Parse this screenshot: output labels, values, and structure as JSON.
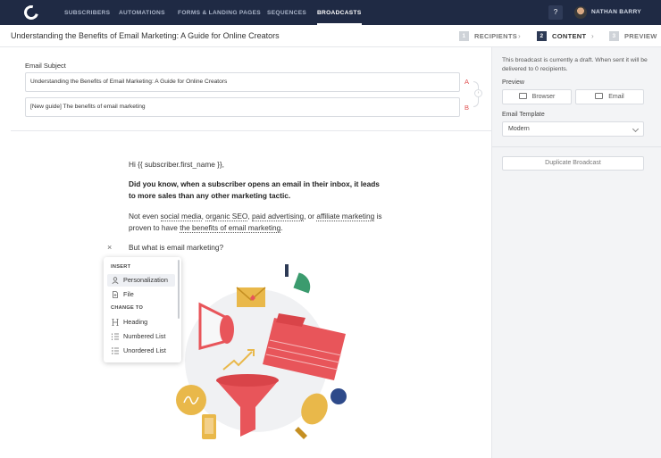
{
  "nav": {
    "items": [
      "SUBSCRIBERS",
      "AUTOMATIONS",
      "FORMS & LANDING PAGES",
      "SEQUENCES",
      "BROADCASTS"
    ],
    "active": "BROADCASTS",
    "help": "?",
    "user": "NATHAN BARRY"
  },
  "header": {
    "title": "Understanding the Benefits of Email Marketing: A Guide for Online Creators",
    "steps": [
      {
        "num": "1",
        "label": "RECIPIENTS"
      },
      {
        "num": "2",
        "label": "CONTENT"
      },
      {
        "num": "3",
        "label": "PREVIEW"
      }
    ],
    "separator": "›"
  },
  "subject": {
    "label": "Email Subject",
    "a_value": "Understanding the Benefits of Email Marketing: A Guide for Online Creators",
    "b_value": "[New guide] The benefits of email marketing",
    "a_tag": "A",
    "b_tag": "B"
  },
  "sidebar": {
    "draft_note": "This broadcast is currently a draft. When sent it will be delivered to 0 recipients.",
    "preview_label": "Preview",
    "browser_btn": "Browser",
    "email_btn": "Email",
    "template_label": "Email Template",
    "template_value": "Modern",
    "duplicate_btn": "Duplicate Broadcast"
  },
  "body": {
    "greeting": "Hi {{ subscriber.first_name }},",
    "bold_para": "Did you know, when a subscriber opens an email in their inbox, it leads to more sales than any other marketing tactic.",
    "p2_start": "Not even ",
    "link1": "social media",
    "sep1": ", ",
    "link2": "organic SEO",
    "sep2": ", ",
    "link3": "paid advertising",
    "sep3": ", or ",
    "link4": "affiliate marketing",
    "p2_mid": " is proven to have ",
    "link5": "the benefits of email marketing",
    "p2_end": ".",
    "question": "But what is email marketing?",
    "close": "×"
  },
  "menu": {
    "insert_head": "INSERT",
    "change_head": "CHANGE TO",
    "items": [
      {
        "label": "Personalization",
        "icon": "person-icon"
      },
      {
        "label": "File",
        "icon": "file-icon"
      },
      {
        "label": "Heading",
        "icon": "heading-icon"
      },
      {
        "label": "Numbered List",
        "icon": "numbered-list-icon"
      },
      {
        "label": "Unordered List",
        "icon": "unordered-list-icon"
      }
    ]
  },
  "colors": {
    "nav_bg": "#1f2a44",
    "accent_red": "#e05252",
    "illus_red": "#e8555a",
    "illus_green": "#3b9b6e",
    "illus_yellow": "#e9b84a",
    "illus_navy": "#2e4a8a"
  }
}
